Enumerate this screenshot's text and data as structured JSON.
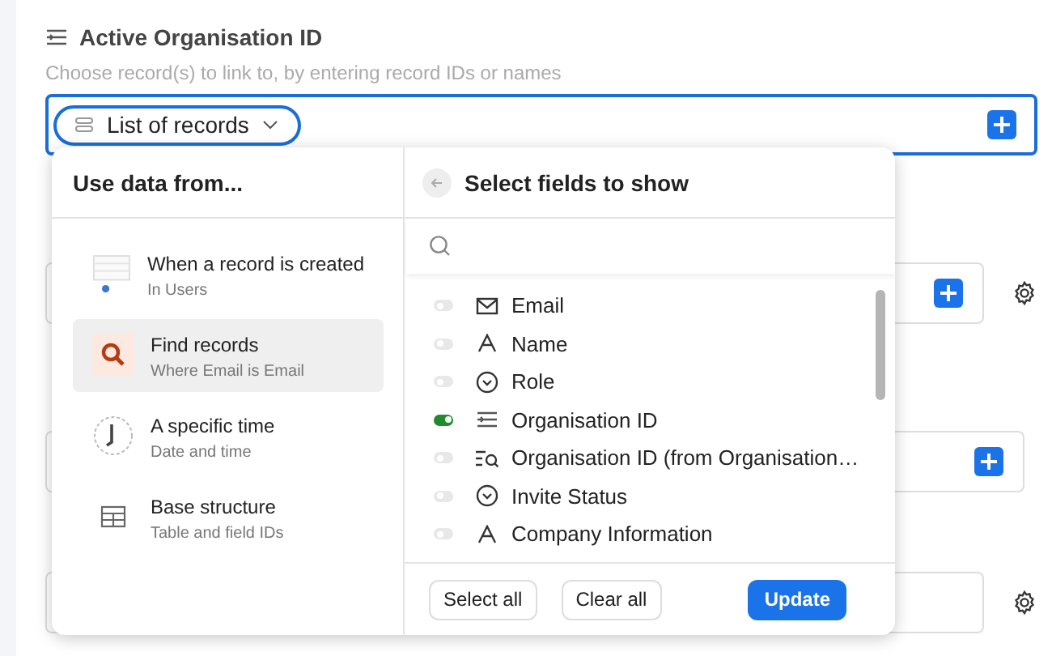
{
  "field": {
    "label": "Active Organisation ID",
    "hint": "Choose record(s) to link to, by entering record IDs or names",
    "pill": "List of records"
  },
  "background_rows": [
    {
      "add_button": true,
      "settings": true
    },
    {
      "add_button": true,
      "settings": false
    },
    {
      "add_button": false,
      "settings": true
    }
  ],
  "popup": {
    "left_title": "Use data from...",
    "sources": [
      {
        "kind": "trigger",
        "title": "When a record is created",
        "subtitle": "In Users",
        "selected": false
      },
      {
        "kind": "find",
        "title": "Find records",
        "subtitle": "Where Email is Email",
        "selected": true
      },
      {
        "kind": "time",
        "title": "A specific time",
        "subtitle": "Date and time",
        "selected": false
      },
      {
        "kind": "structure",
        "title": "Base structure",
        "subtitle": "Table and field IDs",
        "selected": false
      }
    ],
    "right_title": "Select fields to show",
    "fields": [
      {
        "kind": "email",
        "name": "Email",
        "on": false
      },
      {
        "kind": "text",
        "name": "Name",
        "on": false
      },
      {
        "kind": "select",
        "name": "Role",
        "on": false
      },
      {
        "kind": "link",
        "name": "Organisation ID",
        "on": true
      },
      {
        "kind": "lookup",
        "name": "Organisation ID (from Organisation…",
        "on": false
      },
      {
        "kind": "select",
        "name": "Invite Status",
        "on": false
      },
      {
        "kind": "text",
        "name": "Company Information",
        "on": false
      }
    ],
    "buttons": [
      {
        "kind": "secondary",
        "label": "Select all"
      },
      {
        "kind": "secondary",
        "label": "Clear all"
      },
      {
        "kind": "primary",
        "label": "Update"
      }
    ]
  }
}
